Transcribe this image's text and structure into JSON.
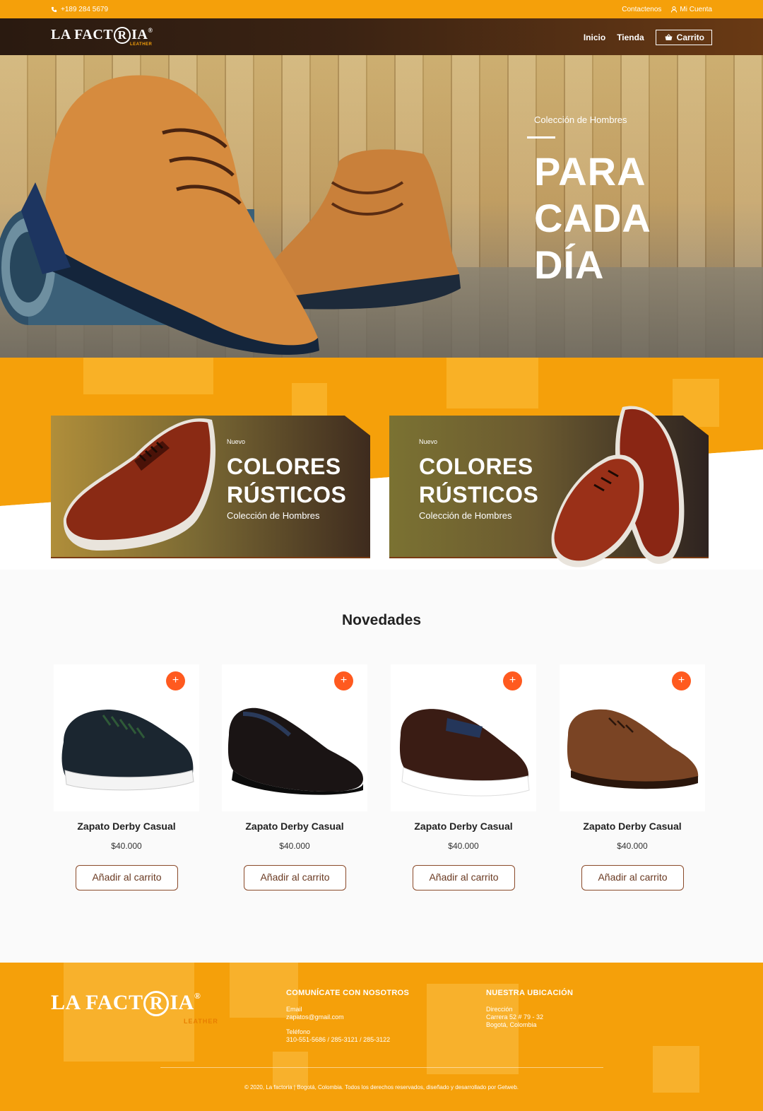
{
  "topbar": {
    "phone": "+189 284 5679",
    "contact": "Contactenos",
    "account": "Mi Cuenta"
  },
  "brand": {
    "logo_left": "LA FACT",
    "logo_circle": "R",
    "logo_right": "IA",
    "logo_reg": "®",
    "logo_sub": "LEATHER"
  },
  "nav": {
    "home": "Inicio",
    "shop": "Tienda",
    "cart": "Carrito"
  },
  "hero": {
    "kicker": "Colección de Hombres",
    "line1": "PARA",
    "line2": "CADA",
    "line3": "DÍA"
  },
  "promos": [
    {
      "tag": "Nuevo",
      "line1": "COLORES",
      "line2": "RÚSTICOS",
      "subtitle": "Colección de Hombres"
    },
    {
      "tag": "Nuevo",
      "line1": "COLORES",
      "line2": "RÚSTICOS",
      "subtitle": "Colección de Hombres"
    }
  ],
  "section": {
    "title": "Novedades"
  },
  "products": [
    {
      "name": "Zapato Derby Casual",
      "price": "$40.000",
      "button": "Añadir al carrito",
      "plus": "+"
    },
    {
      "name": "Zapato Derby Casual",
      "price": "$40.000",
      "button": "Añadir al carrito",
      "plus": "+"
    },
    {
      "name": "Zapato Derby Casual",
      "price": "$40.000",
      "button": "Añadir al carrito",
      "plus": "+"
    },
    {
      "name": "Zapato Derby Casual",
      "price": "$40.000",
      "button": "Añadir al carrito",
      "plus": "+"
    }
  ],
  "footer": {
    "contact_title": "COMUNÍCATE CON NOSOTROS",
    "email_label": "Email",
    "email": "zapatos@gmail.com",
    "phone_label": "Teléfono",
    "phones": "310-551-5686 / 285-3121 / 285-3122",
    "location_title": "NUESTRA UBICACIÓN",
    "address_label": "Dirección",
    "address": "Carrera 52 # 79 - 32",
    "city": "Bogotá, Colombia",
    "copyright": "© 2020, La factoria | Bogotá, Colombia. Todos los derechos reservados, diseñado y desarrollado por Getweb."
  },
  "colors": {
    "accent_orange": "#f5a00a",
    "plus_button": "#ff5a1f",
    "nav_dark": "#2a1a10",
    "button_border": "#8a4a2a"
  },
  "icons": {
    "phone": "phone-icon",
    "user": "user-icon",
    "cart": "basket-icon",
    "plus": "plus-icon"
  }
}
